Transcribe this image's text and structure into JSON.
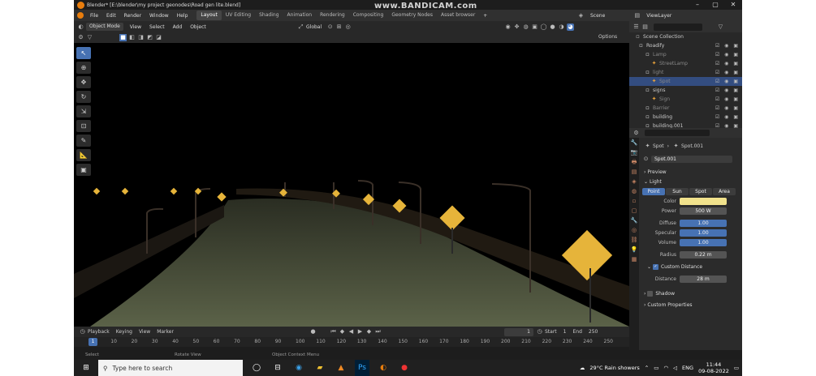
{
  "window": {
    "title": "Blender* [E:\\blender\\my project geonodes\\Road gen lite.blend]",
    "watermark": "www.BANDICAM.com"
  },
  "menu": [
    "File",
    "Edit",
    "Render",
    "Window",
    "Help"
  ],
  "workspaces": [
    "Layout",
    "UV Editing",
    "Shading",
    "Animation",
    "Rendering",
    "Compositing",
    "Geometry Nodes",
    "Asset browser"
  ],
  "scene": "Scene",
  "view_layer": "ViewLayer",
  "vp_header": {
    "mode": "Object Mode",
    "view": "View",
    "select": "Select",
    "add": "Add",
    "object": "Object",
    "orientation": "Global",
    "options": "Options"
  },
  "outliner": {
    "title": "Scene Collection",
    "items": [
      {
        "label": "Roadify",
        "indent": 0,
        "dim": false,
        "sel": false
      },
      {
        "label": "Lamp",
        "indent": 1,
        "dim": true,
        "sel": false
      },
      {
        "label": "StreetLamp",
        "indent": 2,
        "dim": true,
        "sel": false
      },
      {
        "label": "light",
        "indent": 1,
        "dim": true,
        "sel": false
      },
      {
        "label": "Spot",
        "indent": 2,
        "dim": true,
        "sel": true
      },
      {
        "label": "signs",
        "indent": 1,
        "dim": false,
        "sel": false
      },
      {
        "label": "Sign",
        "indent": 2,
        "dim": true,
        "sel": false
      },
      {
        "label": "Barrier",
        "indent": 1,
        "dim": true,
        "sel": false
      },
      {
        "label": "building",
        "indent": 1,
        "dim": false,
        "sel": false
      },
      {
        "label": "building.001",
        "indent": 1,
        "dim": false,
        "sel": false
      }
    ]
  },
  "props": {
    "crumb_a": "Spot",
    "crumb_b": "Spot.001",
    "datablock": "Spot.001",
    "preview": "Preview",
    "light": "Light",
    "types": [
      "Point",
      "Sun",
      "Spot",
      "Area"
    ],
    "color_label": "Color",
    "color_hex": "#f1e28c",
    "power_label": "Power",
    "power": "500 W",
    "diffuse_label": "Diffuse",
    "diffuse": "1.00",
    "specular_label": "Specular",
    "specular": "1.00",
    "volume_label": "Volume",
    "volume": "1.00",
    "radius_label": "Radius",
    "radius": "0.22 m",
    "custom_distance": "Custom Distance",
    "distance_label": "Distance",
    "distance": "28 m",
    "shadow": "Shadow",
    "custom_props": "Custom Properties"
  },
  "timeline": {
    "playback": "Playback",
    "keying": "Keying",
    "view": "View",
    "marker": "Marker",
    "current": "1",
    "start_label": "Start",
    "start": "1",
    "end_label": "End",
    "end": "250",
    "ticks": [
      "1",
      "10",
      "20",
      "30",
      "40",
      "50",
      "60",
      "70",
      "80",
      "90",
      "100",
      "110",
      "120",
      "130",
      "140",
      "150",
      "160",
      "170",
      "180",
      "190",
      "200",
      "210",
      "220",
      "230",
      "240",
      "250"
    ]
  },
  "status": {
    "select": "Select",
    "rotate": "Rotate View",
    "context": "Object Context Menu"
  },
  "taskbar": {
    "search": "Type here to search",
    "weather": "29°C Rain showers",
    "lang": "ENG",
    "time": "11:44",
    "date": "09-08-2022"
  }
}
